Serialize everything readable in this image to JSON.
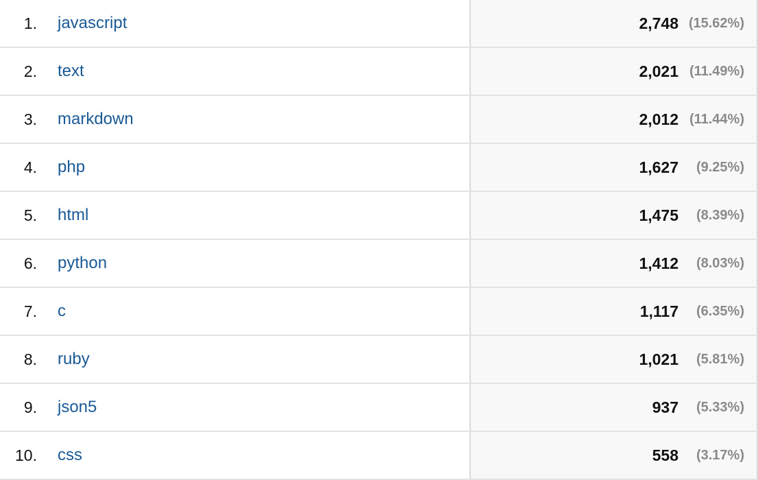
{
  "rows": [
    {
      "rank": "1.",
      "label": "javascript",
      "value": "2,748",
      "percent": "(15.62%)"
    },
    {
      "rank": "2.",
      "label": "text",
      "value": "2,021",
      "percent": "(11.49%)"
    },
    {
      "rank": "3.",
      "label": "markdown",
      "value": "2,012",
      "percent": "(11.44%)"
    },
    {
      "rank": "4.",
      "label": "php",
      "value": "1,627",
      "percent": "(9.25%)"
    },
    {
      "rank": "5.",
      "label": "html",
      "value": "1,475",
      "percent": "(8.39%)"
    },
    {
      "rank": "6.",
      "label": "python",
      "value": "1,412",
      "percent": "(8.03%)"
    },
    {
      "rank": "7.",
      "label": "c",
      "value": "1,117",
      "percent": "(6.35%)"
    },
    {
      "rank": "8.",
      "label": "ruby",
      "value": "1,021",
      "percent": "(5.81%)"
    },
    {
      "rank": "9.",
      "label": "json5",
      "value": "937",
      "percent": "(5.33%)"
    },
    {
      "rank": "10.",
      "label": "css",
      "value": "558",
      "percent": "(3.17%)"
    }
  ]
}
